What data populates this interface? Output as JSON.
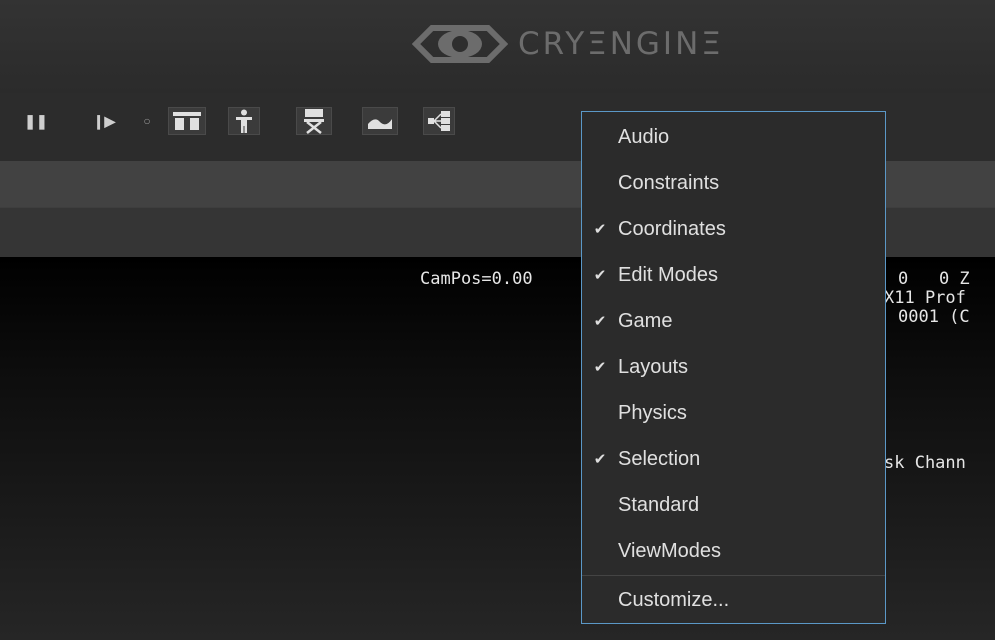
{
  "title_bar": {
    "logo_text": "CRYΞNGINΞ",
    "logo_icon": "cryengine-eye-icon"
  },
  "toolbar": {
    "buttons": [
      {
        "name": "pause-icon",
        "glyph": "❚❚"
      },
      {
        "name": "step-icon",
        "glyph": "❙▶"
      },
      {
        "name": "record-dot-icon",
        "glyph": "○"
      },
      {
        "name": "layout-icon"
      },
      {
        "name": "character-icon"
      },
      {
        "name": "director-chair-icon"
      },
      {
        "name": "terrain-icon"
      },
      {
        "name": "flowgraph-icon"
      }
    ]
  },
  "viewport": {
    "lines": [
      "CamPos=0.00",
      "0   0 Z",
      "X11 Prof",
      "0001 (C",
      "sk Chann"
    ]
  },
  "menu": {
    "items": [
      {
        "label": "Audio",
        "checked": false
      },
      {
        "label": "Constraints",
        "checked": false
      },
      {
        "label": "Coordinates",
        "checked": true
      },
      {
        "label": "Edit Modes",
        "checked": true
      },
      {
        "label": "Game",
        "checked": true
      },
      {
        "label": "Layouts",
        "checked": true
      },
      {
        "label": "Physics",
        "checked": false
      },
      {
        "label": "Selection",
        "checked": true
      },
      {
        "label": "Standard",
        "checked": false
      },
      {
        "label": "ViewModes",
        "checked": false
      }
    ],
    "customize_label": "Customize...",
    "check_glyph": "✔"
  },
  "colors": {
    "accent_border": "#5b98c7",
    "menu_bg": "#2b2b2b",
    "menu_text": "#e0e0e0"
  }
}
